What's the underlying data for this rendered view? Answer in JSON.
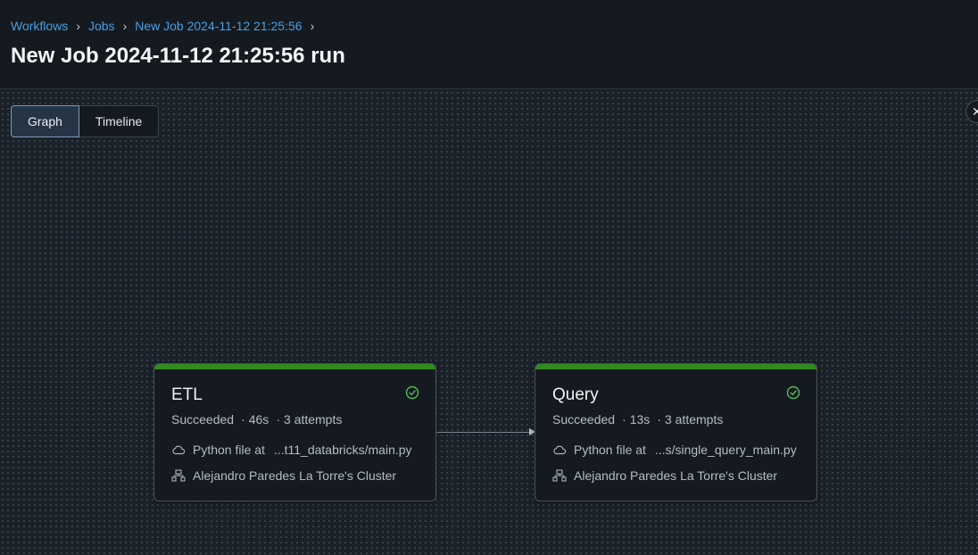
{
  "breadcrumb": {
    "items": [
      "Workflows",
      "Jobs",
      "New Job 2024-11-12 21:25:56"
    ],
    "separator": "›"
  },
  "page": {
    "title": "New Job 2024-11-12 21:25:56 run"
  },
  "view_toggle": {
    "graph_label": "Graph",
    "timeline_label": "Timeline",
    "selected": "Graph"
  },
  "close_label": "✕",
  "colors": {
    "link": "#4a9fe3",
    "success": "#2f8a1f",
    "success_icon": "#5bb85b"
  },
  "tasks": [
    {
      "name": "ETL",
      "status": "Succeeded",
      "duration": "46s",
      "attempts": "3 attempts",
      "source_prefix": "Python file at",
      "source_path": "...t11_databricks/main.py",
      "cluster": "Alejandro Paredes La Torre's Cluster",
      "status_icon": "check-circle-icon"
    },
    {
      "name": "Query",
      "status": "Succeeded",
      "duration": "13s",
      "attempts": "3 attempts",
      "source_prefix": "Python file at",
      "source_path": "...s/single_query_main.py",
      "cluster": "Alejandro Paredes La Torre's Cluster",
      "status_icon": "check-circle-icon"
    }
  ]
}
